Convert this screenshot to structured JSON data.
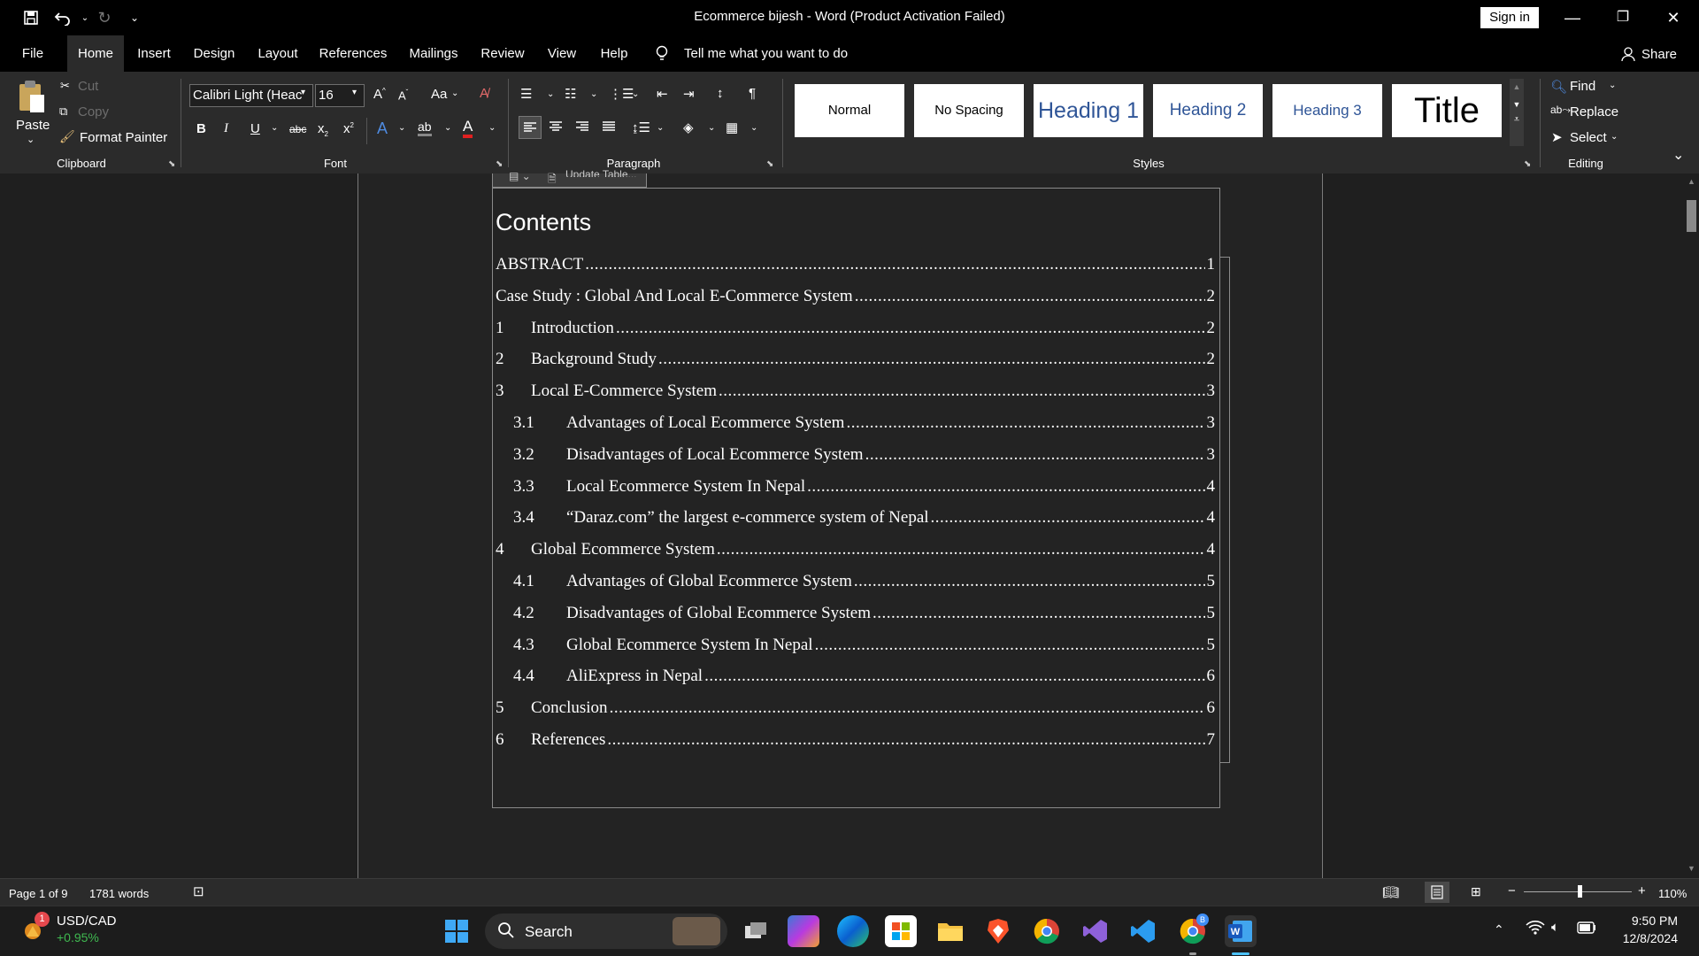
{
  "titlebar": {
    "document_title": "Ecommerce bijesh  -  Word (Product Activation Failed)",
    "signin_label": "Sign in"
  },
  "menu": {
    "tabs": [
      "File",
      "Home",
      "Insert",
      "Design",
      "Layout",
      "References",
      "Mailings",
      "Review",
      "View",
      "Help"
    ],
    "active_tab": "Home",
    "tell_me": "Tell me what you want to do",
    "share": "Share"
  },
  "ribbon": {
    "clipboard": {
      "paste": "Paste",
      "cut": "Cut",
      "copy": "Copy",
      "format_painter": "Format Painter",
      "label": "Clipboard"
    },
    "font": {
      "font_name": "Calibri Light (Heac",
      "font_size": "16",
      "change_case": "Aa",
      "label": "Font"
    },
    "paragraph": {
      "label": "Paragraph"
    },
    "styles": {
      "items": [
        "Normal",
        "No Spacing",
        "Heading 1",
        "Heading 2",
        "Heading 3",
        "Title"
      ],
      "label": "Styles"
    },
    "editing": {
      "find": "Find",
      "replace": "Replace",
      "select": "Select",
      "label": "Editing"
    }
  },
  "document": {
    "toc_tab_label": "Update Table...",
    "toc_title": "Contents",
    "toc": [
      {
        "num": "",
        "text": "ABSTRACT",
        "page": "1",
        "level": 0
      },
      {
        "num": "",
        "text": "Case Study : Global And Local E-Commerce System",
        "page": "2",
        "level": 0
      },
      {
        "num": "1",
        "text": "Introduction",
        "page": "2",
        "level": 1
      },
      {
        "num": "2",
        "text": "Background Study",
        "page": "2",
        "level": 1
      },
      {
        "num": "3",
        "text": "Local E-Commerce System",
        "page": "3",
        "level": 1
      },
      {
        "num": "3.1",
        "text": "Advantages of Local Ecommerce System",
        "page": "3",
        "level": 2
      },
      {
        "num": "3.2",
        "text": "Disadvantages of Local Ecommerce System",
        "page": "3",
        "level": 2
      },
      {
        "num": "3.3",
        "text": "Local Ecommerce System In Nepal",
        "page": "4",
        "level": 2
      },
      {
        "num": "3.4",
        "text": "“Daraz.com” the largest e-commerce system of Nepal",
        "page": "4",
        "level": 2
      },
      {
        "num": "4",
        "text": "Global Ecommerce System",
        "page": "4",
        "level": 1
      },
      {
        "num": "4.1",
        "text": "Advantages of Global Ecommerce System",
        "page": "5",
        "level": 2
      },
      {
        "num": "4.2",
        "text": "Disadvantages of Global Ecommerce System",
        "page": "5",
        "level": 2
      },
      {
        "num": "4.3",
        "text": "Global Ecommerce System In Nepal",
        "page": "5",
        "level": 2
      },
      {
        "num": "4.4",
        "text": "AliExpress in Nepal",
        "page": "6",
        "level": 2
      },
      {
        "num": "5",
        "text": "Conclusion",
        "page": "6",
        "level": 1
      },
      {
        "num": "6",
        "text": "References",
        "page": "7",
        "level": 1
      }
    ]
  },
  "statusbar": {
    "page": "Page 1 of 9",
    "words": "1781 words",
    "zoom": "110%",
    "zoom_level_percent": 110
  },
  "taskbar": {
    "widget_title": "USD/CAD",
    "widget_value": "+0.95%",
    "widget_badge": "1",
    "search": "Search",
    "chrome_badge": "B",
    "time": "9:50 PM",
    "date": "12/8/2024"
  },
  "colors": {
    "title_bg": "#000000",
    "ribbon_bg": "#2b2b2b",
    "doc_bg": "#1f1f1f",
    "heading_blue": "#2f5597",
    "accent_green": "#3fb950"
  }
}
